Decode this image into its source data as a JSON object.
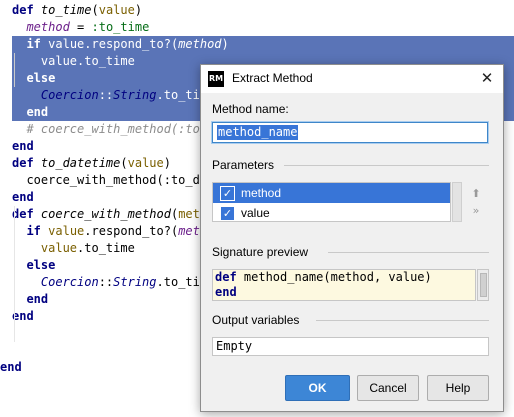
{
  "editor": {
    "lines": [
      {
        "indent": "",
        "parts": [
          [
            "kw",
            "def "
          ],
          [
            "fn",
            "to_time"
          ],
          [
            "txt",
            "("
          ],
          [
            "arg",
            "value"
          ],
          [
            "txt",
            ")"
          ]
        ],
        "sel": false
      },
      {
        "indent": "  ",
        "parts": [
          [
            "lv",
            "method"
          ],
          [
            "txt",
            " = "
          ],
          [
            "sym",
            ":to_time"
          ]
        ],
        "sel": false
      },
      {
        "indent": "  ",
        "parts": [
          [
            "kw",
            "if "
          ],
          [
            "txt",
            "value.respond_to?("
          ],
          [
            "lv",
            "method"
          ],
          [
            "txt",
            ")"
          ]
        ],
        "sel": true
      },
      {
        "indent": "    ",
        "parts": [
          [
            "txt",
            "value.to_time"
          ]
        ],
        "sel": true
      },
      {
        "indent": "  ",
        "parts": [
          [
            "kw",
            "else"
          ]
        ],
        "sel": true
      },
      {
        "indent": "    ",
        "parts": [
          [
            "cls",
            "Coercion"
          ],
          [
            "txt",
            "::"
          ],
          [
            "cls",
            "String"
          ],
          [
            "txt",
            ".to_tim"
          ]
        ],
        "sel": true
      },
      {
        "indent": "  ",
        "parts": [
          [
            "kw",
            "end"
          ]
        ],
        "sel": true
      },
      {
        "indent": "  ",
        "parts": [
          [
            "cmt",
            "# coerce_with_method(:to_"
          ]
        ],
        "sel": false
      },
      {
        "indent": "",
        "parts": [
          [
            "kw",
            "end"
          ]
        ],
        "sel": false
      },
      {
        "indent": "",
        "parts": [
          [
            "kw",
            "def "
          ],
          [
            "fn",
            "to_datetime"
          ],
          [
            "txt",
            "("
          ],
          [
            "arg",
            "value"
          ],
          [
            "txt",
            ")"
          ]
        ],
        "sel": false
      },
      {
        "indent": "  ",
        "parts": [
          [
            "txt",
            "coerce_with_method(:to_da"
          ]
        ],
        "sel": false
      },
      {
        "indent": "",
        "parts": [
          [
            "kw",
            "end"
          ]
        ],
        "sel": false
      },
      {
        "indent": "",
        "parts": [
          [
            "kw",
            "def "
          ],
          [
            "fn",
            "coerce_with_method"
          ],
          [
            "txt",
            "("
          ],
          [
            "arg",
            "meth"
          ]
        ],
        "sel": false
      },
      {
        "indent": "  ",
        "parts": [
          [
            "kw",
            "if "
          ],
          [
            "arg",
            "value"
          ],
          [
            "txt",
            ".respond_to?("
          ],
          [
            "lv",
            "meth"
          ]
        ],
        "sel": false
      },
      {
        "indent": "    ",
        "parts": [
          [
            "arg",
            "value"
          ],
          [
            "txt",
            ".to_time"
          ]
        ],
        "sel": false
      },
      {
        "indent": "  ",
        "parts": [
          [
            "kw",
            "else"
          ]
        ],
        "sel": false
      },
      {
        "indent": "    ",
        "parts": [
          [
            "cls",
            "Coercion"
          ],
          [
            "txt",
            "::"
          ],
          [
            "cls",
            "String"
          ],
          [
            "txt",
            ".to_tim"
          ]
        ],
        "sel": false
      },
      {
        "indent": "  ",
        "parts": [
          [
            "kw",
            "end"
          ]
        ],
        "sel": false
      },
      {
        "indent": "",
        "parts": [
          [
            "kw",
            "end"
          ]
        ],
        "sel": false
      },
      {
        "indent": "",
        "parts": [],
        "sel": false
      },
      {
        "indent": "",
        "parts": [],
        "sel": false
      },
      {
        "indent": "",
        "parts": [
          [
            "kw",
            "end"
          ]
        ],
        "sel": false
      }
    ]
  },
  "dialog": {
    "icon_text": "RM",
    "title": "Extract Method",
    "close_glyph": "✕",
    "method_name_label": "Method name:",
    "method_name_value": "method_name",
    "parameters_label": "Parameters",
    "params": [
      {
        "name": "method",
        "checked": true,
        "selected": true
      },
      {
        "name": "value",
        "checked": true,
        "selected": false
      }
    ],
    "move_up_icon": "⬆",
    "move_down_icon": "»",
    "signature_label": "Signature preview",
    "signature_lines": [
      "def method_name(method, value)",
      "end"
    ],
    "output_label": "Output variables",
    "output_value": "Empty",
    "buttons": {
      "ok": "OK",
      "cancel": "Cancel",
      "help": "Help"
    }
  }
}
